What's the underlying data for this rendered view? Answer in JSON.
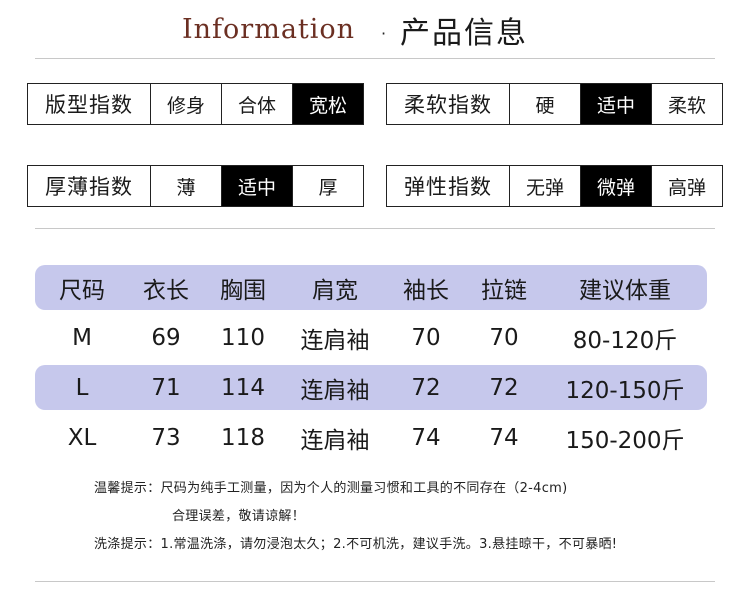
{
  "header": {
    "title_en": "Information",
    "dot": "·",
    "title_cn": "产品信息"
  },
  "specs": [
    {
      "label": "版型指数",
      "options": [
        "修身",
        "合体",
        "宽松"
      ],
      "selected": 2
    },
    {
      "label": "柔软指数",
      "options": [
        "硬",
        "适中",
        "柔软"
      ],
      "selected": 1
    },
    {
      "label": "厚薄指数",
      "options": [
        "薄",
        "适中",
        "厚"
      ],
      "selected": 1
    },
    {
      "label": "弹性指数",
      "options": [
        "无弹",
        "微弹",
        "高弹"
      ],
      "selected": 1
    }
  ],
  "size_table": {
    "headers": [
      "尺码",
      "衣长",
      "胸围",
      "肩宽",
      "袖长",
      "拉链",
      "建议体重"
    ],
    "rows": [
      [
        "M",
        "69",
        "110",
        "连肩袖",
        "70",
        "70",
        "80-120斤"
      ],
      [
        "L",
        "71",
        "114",
        "连肩袖",
        "72",
        "72",
        "120-150斤"
      ],
      [
        "XL",
        "73",
        "118",
        "连肩袖",
        "74",
        "74",
        "150-200斤"
      ]
    ],
    "band_color": "#c6c8ec"
  },
  "notes": {
    "tip_line1": "温馨提示：尺码为纯手工测量，因为个人的测量习惯和工具的不同存在（2-4cm)",
    "tip_line2": "合理误差，敬请谅解！",
    "wash": "洗涤提示：1.常温洗涤，请勿浸泡太久；2.不可机洗，建议手洗。3.悬挂晾干，不可暴晒!"
  }
}
